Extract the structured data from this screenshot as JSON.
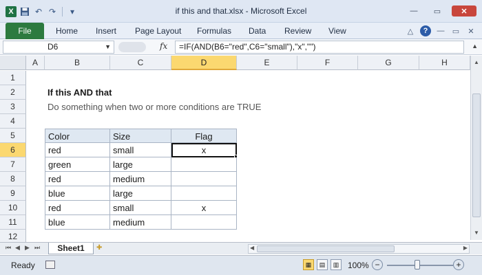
{
  "window": {
    "title": "if this and that.xlsx  -  Microsoft Excel",
    "qat_excel_icon": "X",
    "undo_icon": "↶",
    "redo_icon": "↷",
    "customize_icon": "▾"
  },
  "window_controls": {
    "minimize": "—",
    "restore": "▭",
    "close": "✕"
  },
  "ribbon": {
    "tabs": [
      "File",
      "Home",
      "Insert",
      "Page Layout",
      "Formulas",
      "Data",
      "Review",
      "View"
    ],
    "minimize_icon": "△",
    "help_icon": "?",
    "win_minimize": "—",
    "win_restore": "▭",
    "win_close": "✕"
  },
  "formula_bar": {
    "name_box": "D6",
    "name_box_arrow": "▼",
    "fx_label": "fx",
    "formula": "=IF(AND(B6=\"red\",C6=\"small\"),\"x\",\"\")",
    "expand_icon": "▲"
  },
  "columns": [
    "A",
    "B",
    "C",
    "D",
    "E",
    "F",
    "G",
    "H"
  ],
  "selected_column": "D",
  "rows": [
    "1",
    "2",
    "3",
    "4",
    "5",
    "6",
    "7",
    "8",
    "9",
    "10",
    "11",
    "12"
  ],
  "selected_row": "6",
  "sheet": {
    "heading": "If this AND that",
    "subheading": "Do something when two or more conditions are TRUE",
    "table_headers": [
      "Color",
      "Size",
      "Flag"
    ],
    "table_rows": [
      [
        "red",
        "small",
        "x"
      ],
      [
        "green",
        "large",
        ""
      ],
      [
        "red",
        "medium",
        ""
      ],
      [
        "blue",
        "large",
        ""
      ],
      [
        "red",
        "small",
        "x"
      ],
      [
        "blue",
        "medium",
        ""
      ]
    ]
  },
  "colors": {
    "table_header_fill": "#dfe8f2",
    "selected_header": "#fbd870",
    "file_tab": "#2c7a3f"
  },
  "scrollbar": {
    "up": "▲",
    "down": "▼"
  },
  "sheet_tabs": {
    "nav": [
      "⏮",
      "◀",
      "▶",
      "⏭"
    ],
    "active": "Sheet1",
    "new_sheet_icon": "✚",
    "left_arrow": "◀",
    "right_arrow": "▶"
  },
  "status_bar": {
    "status": "Ready",
    "zoom_label": "100%",
    "zoom_minus": "−",
    "zoom_plus": "+",
    "zoom_level_percent": 100,
    "views": [
      "▦",
      "▤",
      "▥"
    ]
  }
}
